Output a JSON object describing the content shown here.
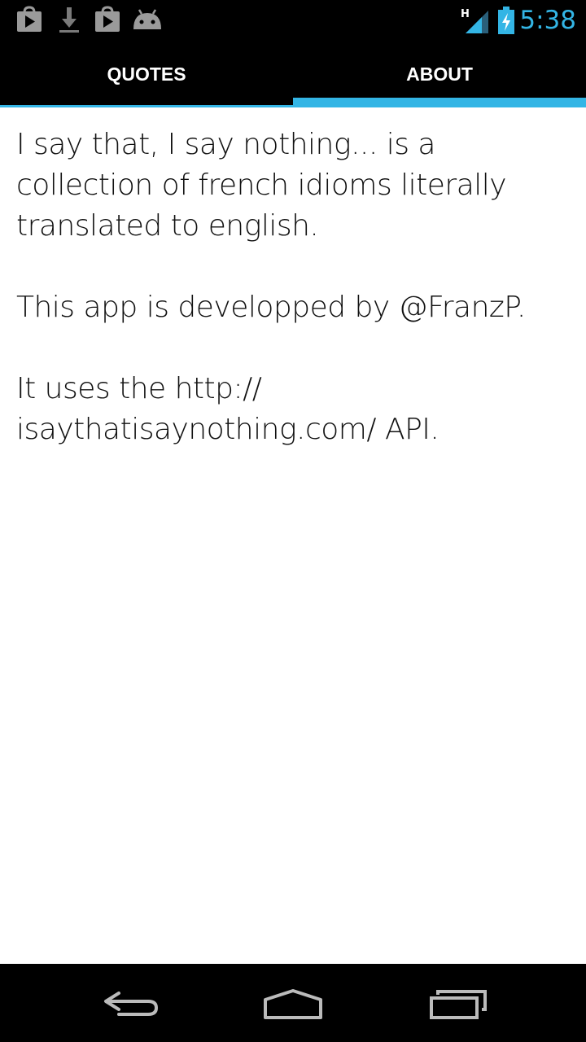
{
  "status_bar": {
    "time": "5:38",
    "network_type": "H",
    "icons": [
      "play-store-icon",
      "download-icon",
      "shopping-bag-icon",
      "android-icon",
      "signal-icon",
      "battery-charging-icon"
    ]
  },
  "tabs": [
    {
      "label": "QUOTES",
      "selected": false
    },
    {
      "label": "ABOUT",
      "selected": true
    }
  ],
  "about": {
    "paragraph1": "I say that, I say nothing... is a collection of french idioms literally translated to english.",
    "paragraph2": "This app is developped by @FranzP.",
    "paragraph3": "It uses the http:// isaythatisaynothing.com/ API."
  },
  "colors": {
    "accent": "#33b5e5",
    "bar_background": "#000000",
    "content_background": "#ffffff"
  },
  "nav_bar": {
    "buttons": [
      "back-icon",
      "home-icon",
      "recent-apps-icon"
    ]
  }
}
